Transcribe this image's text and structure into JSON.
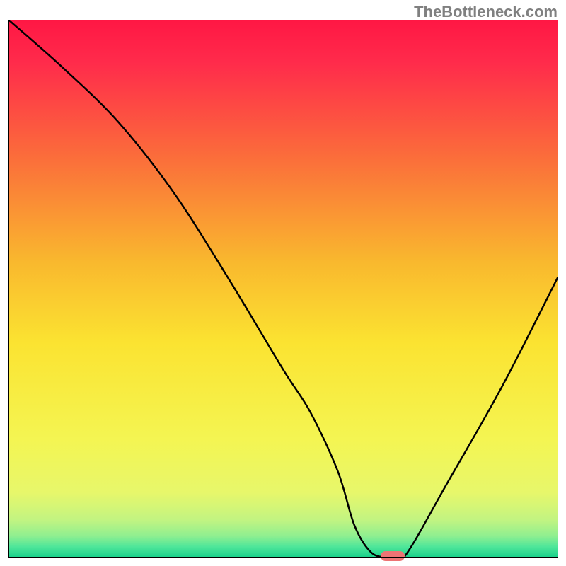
{
  "watermark": "TheBottleneck.com",
  "chart_data": {
    "type": "line",
    "title": "",
    "xlabel": "",
    "ylabel": "",
    "xlim": [
      0,
      100
    ],
    "ylim": [
      0,
      100
    ],
    "grid": false,
    "legend": false,
    "background": "red-yellow-green vertical gradient",
    "series": [
      {
        "name": "bottleneck-curve",
        "x": [
          0,
          10,
          20,
          30,
          40,
          50,
          55,
          60,
          63,
          66,
          69,
          72,
          80,
          90,
          100
        ],
        "y": [
          100,
          91,
          81,
          68,
          52,
          35,
          27,
          16,
          6,
          1,
          0,
          0,
          14,
          32,
          52
        ]
      }
    ],
    "marker": {
      "x_pct": 70,
      "y_pct": 0
    },
    "gradient_stops": [
      {
        "pct": 0,
        "color": "#ff1744"
      },
      {
        "pct": 8,
        "color": "#ff2b4b"
      },
      {
        "pct": 25,
        "color": "#fb6b3b"
      },
      {
        "pct": 45,
        "color": "#f9b82e"
      },
      {
        "pct": 60,
        "color": "#fbe331"
      },
      {
        "pct": 78,
        "color": "#f4f552"
      },
      {
        "pct": 88,
        "color": "#e7f76b"
      },
      {
        "pct": 93,
        "color": "#c2f481"
      },
      {
        "pct": 96,
        "color": "#8fef90"
      },
      {
        "pct": 98,
        "color": "#4fe69a"
      },
      {
        "pct": 100,
        "color": "#17d08a"
      }
    ]
  }
}
